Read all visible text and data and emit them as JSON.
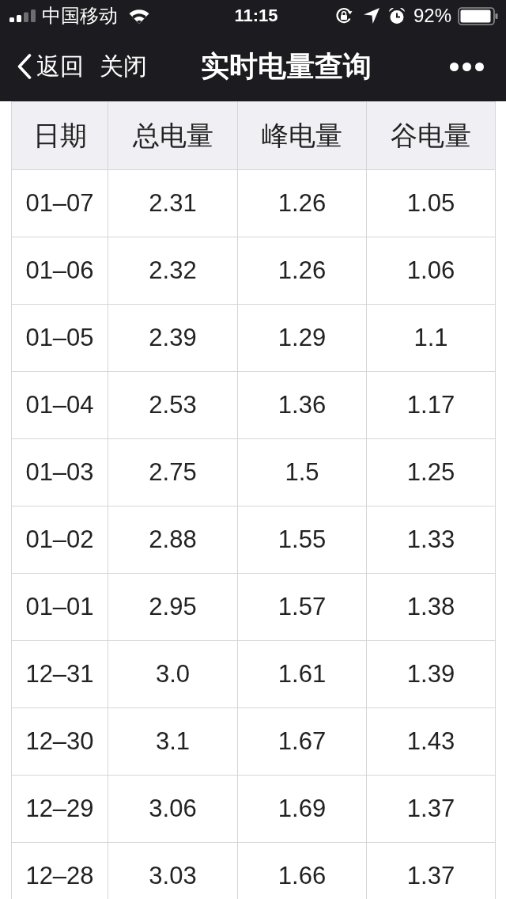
{
  "status_bar": {
    "carrier": "中国移动",
    "time": "11:15",
    "battery": "92%"
  },
  "nav_bar": {
    "back": "返回",
    "close": "关闭",
    "title": "实时电量查询"
  },
  "table": {
    "columns": [
      "日期",
      "总电量",
      "峰电量",
      "谷电量"
    ],
    "rows": [
      [
        "01–07",
        "2.31",
        "1.26",
        "1.05"
      ],
      [
        "01–06",
        "2.32",
        "1.26",
        "1.06"
      ],
      [
        "01–05",
        "2.39",
        "1.29",
        "1.1"
      ],
      [
        "01–04",
        "2.53",
        "1.36",
        "1.17"
      ],
      [
        "01–03",
        "2.75",
        "1.5",
        "1.25"
      ],
      [
        "01–02",
        "2.88",
        "1.55",
        "1.33"
      ],
      [
        "01–01",
        "2.95",
        "1.57",
        "1.38"
      ],
      [
        "12–31",
        "3.0",
        "1.61",
        "1.39"
      ],
      [
        "12–30",
        "3.1",
        "1.67",
        "1.43"
      ],
      [
        "12–29",
        "3.06",
        "1.69",
        "1.37"
      ],
      [
        "12–28",
        "3.03",
        "1.66",
        "1.37"
      ]
    ]
  }
}
